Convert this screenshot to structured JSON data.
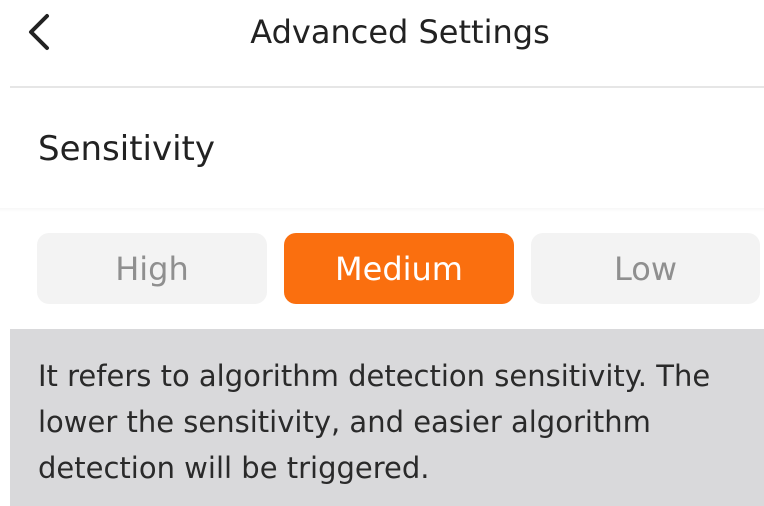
{
  "header": {
    "back_icon": "chevron-left-icon",
    "title": "Advanced Settings"
  },
  "section": {
    "title": "Sensitivity"
  },
  "sensitivity": {
    "options": [
      "High",
      "Medium",
      "Low"
    ],
    "selected": "Medium",
    "accent_color": "#fa6f0f",
    "inactive_bg": "#f3f3f3",
    "inactive_text": "#8f8f8f"
  },
  "info": {
    "text": "It refers to algorithm detection sensitivity. The lower the sensitivity, and easier algorithm detection will be triggered.",
    "background": "#d9d9db"
  }
}
